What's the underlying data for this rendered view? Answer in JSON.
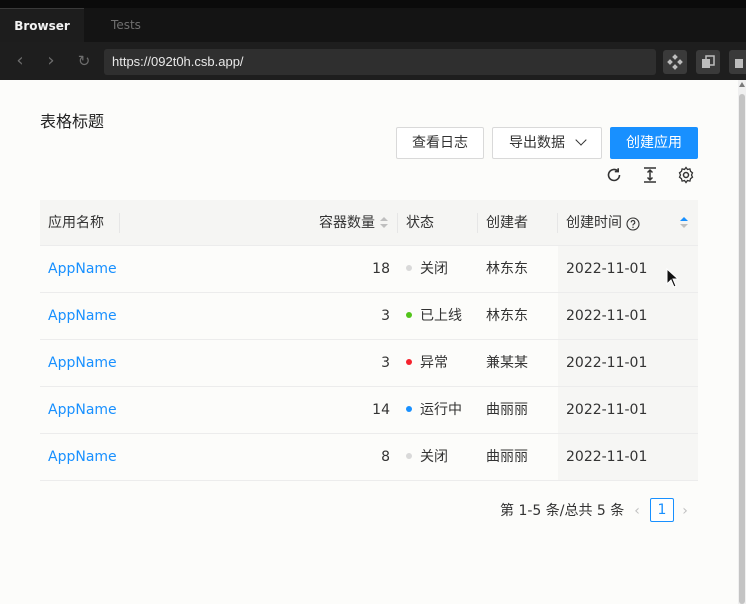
{
  "browser": {
    "tabs": [
      {
        "label": "Browser",
        "active": true
      },
      {
        "label": "Tests",
        "active": false
      }
    ],
    "url": "https://092t0h.csb.app/"
  },
  "page": {
    "title": "表格标题",
    "toolbar": {
      "view_log": "查看日志",
      "export": "导出数据",
      "create": "创建应用"
    },
    "table": {
      "columns": {
        "name": "应用名称",
        "count": "容器数量",
        "status": "状态",
        "creator": "创建者",
        "created": "创建时间"
      },
      "rows": [
        {
          "name": "AppName",
          "count": "18",
          "status": "关闭",
          "status_color": "#d9d9d9",
          "creator": "林东东",
          "created": "2022-11-01"
        },
        {
          "name": "AppName",
          "count": "3",
          "status": "已上线",
          "status_color": "#52c41a",
          "creator": "林东东",
          "created": "2022-11-01"
        },
        {
          "name": "AppName",
          "count": "3",
          "status": "异常",
          "status_color": "#f5222d",
          "creator": "兼某某",
          "created": "2022-11-01"
        },
        {
          "name": "AppName",
          "count": "14",
          "status": "运行中",
          "status_color": "#1890ff",
          "creator": "曲丽丽",
          "created": "2022-11-01"
        },
        {
          "name": "AppName",
          "count": "8",
          "status": "关闭",
          "status_color": "#d9d9d9",
          "creator": "曲丽丽",
          "created": "2022-11-01"
        }
      ]
    },
    "pagination": {
      "total": "第 1-5 条/总共 5 条",
      "current": "1"
    }
  },
  "colors": {
    "primary": "#1890ff"
  }
}
